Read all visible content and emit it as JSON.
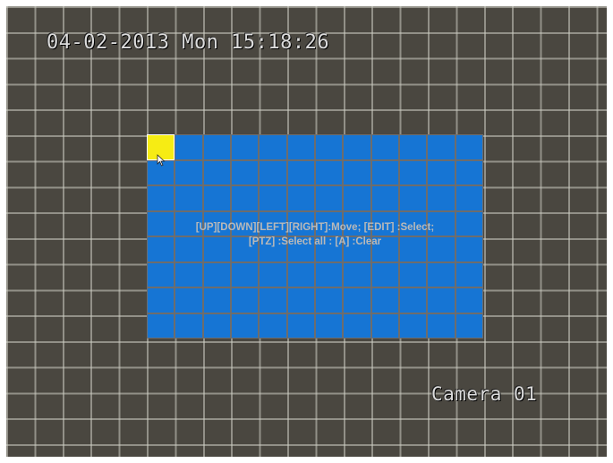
{
  "osd": {
    "datetime": "04-02-2013 Mon 15:18:26",
    "camera_name": "Camera 01"
  },
  "motion_area": {
    "columns": 12,
    "rows": 8,
    "selected_cells": [
      [
        0,
        0
      ]
    ],
    "cell_color": "#1675d4",
    "selected_color": "#f6ec14",
    "help_line_1": "[UP][DOWN][LEFT][RIGHT]:Move; [EDIT] :Select;",
    "help_line_2": "[PTZ] :Select all : [A] :Clear"
  },
  "cursor_icon": "mouse-pointer-icon"
}
